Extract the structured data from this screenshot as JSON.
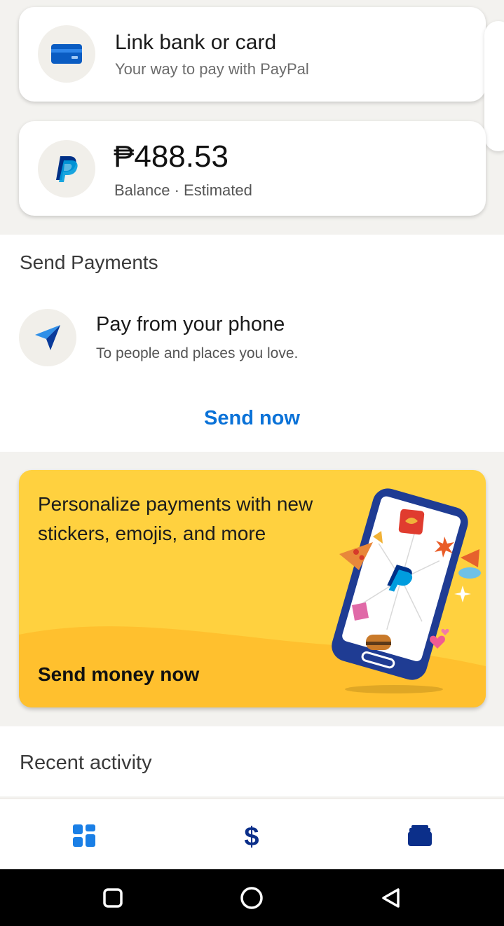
{
  "link_card": {
    "title": "Link bank or card",
    "subtitle": "Your way to pay with PayPal",
    "icon": "credit-card-icon"
  },
  "balance_card": {
    "amount": "₱488.53",
    "subtitle": "Balance · Estimated",
    "icon": "paypal-logo-icon"
  },
  "send_payments": {
    "section_title": "Send Payments",
    "item_title": "Pay from your phone",
    "item_subtitle": "To people and places you love.",
    "action_label": "Send now",
    "icon": "send-arrow-icon"
  },
  "promo": {
    "text": "Personalize payments with new stickers, emojis, and more",
    "cta": "Send money now",
    "background_color": "#ffd13f"
  },
  "recent_activity": {
    "section_title": "Recent activity"
  },
  "tabbar": {
    "items": [
      {
        "icon": "home-grid-icon"
      },
      {
        "icon": "dollar-icon"
      },
      {
        "icon": "wallet-icon"
      }
    ]
  },
  "system_nav": {
    "items": [
      {
        "icon": "recents-square-icon"
      },
      {
        "icon": "home-circle-icon"
      },
      {
        "icon": "back-triangle-icon"
      }
    ]
  },
  "colors": {
    "accent_blue": "#0a72d8",
    "paypal_navy": "#003087",
    "paypal_blue": "#009cde"
  }
}
